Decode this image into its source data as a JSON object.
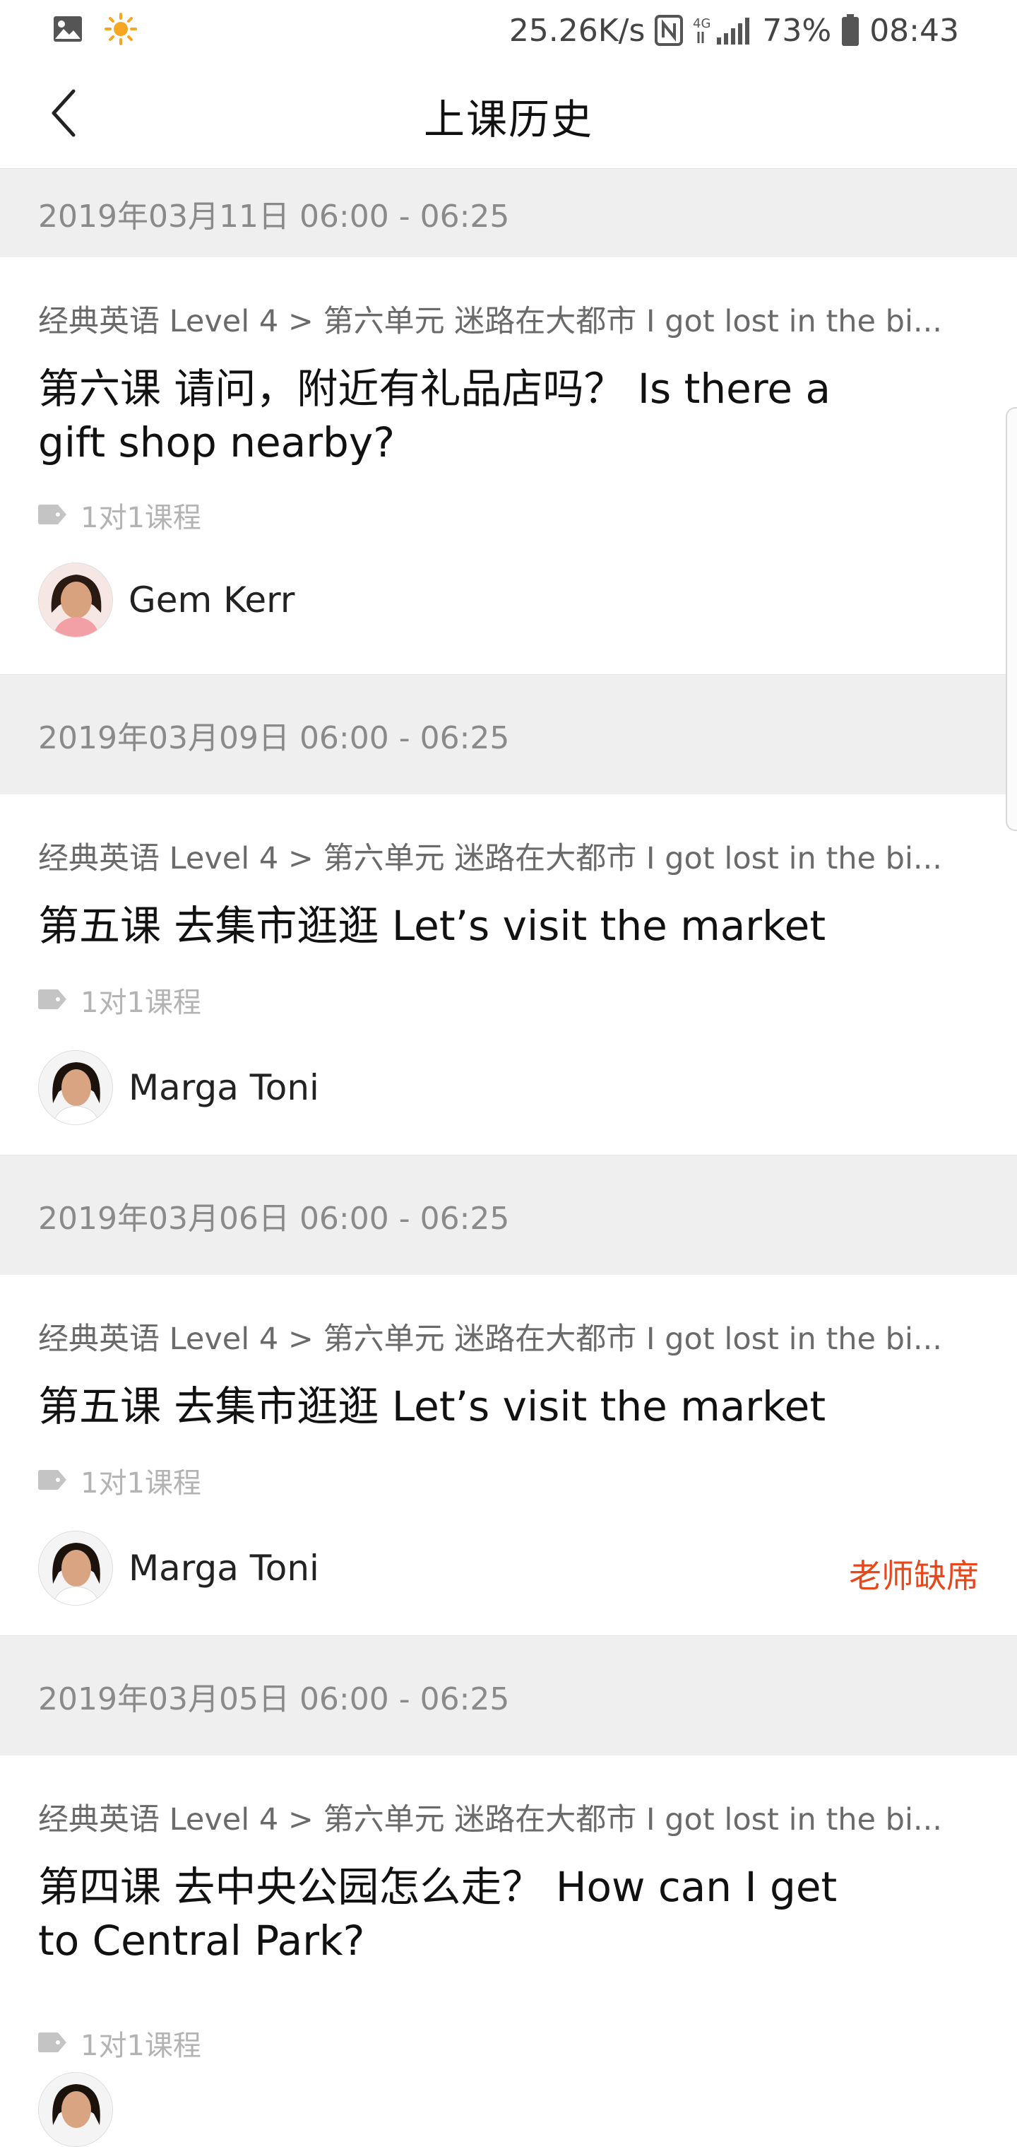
{
  "status_bar": {
    "network_speed": "25.26K/s",
    "signal_label": "4G",
    "battery": "73%",
    "time": "08:43",
    "icons": [
      "image-icon",
      "sun-icon",
      "nfc-icon",
      "signal-icon",
      "battery-icon"
    ]
  },
  "header": {
    "title": "上课历史",
    "back_icon": "chevron-left-icon"
  },
  "records": [
    {
      "date": "2019年03月11日 06:00 - 06:25",
      "course_path": "经典英语 Level 4 > 第六单元 迷路在大都市 I got lost in the bi...",
      "lesson_title": "第六课 请问，附近有礼品店吗？ Is there a gift shop nearby?",
      "tag": "1对1课程",
      "teacher": "Gem Kerr",
      "status": ""
    },
    {
      "date": "2019年03月09日 06:00 - 06:25",
      "course_path": "经典英语 Level 4 > 第六单元 迷路在大都市 I got lost in the bi...",
      "lesson_title": "第五课 去集市逛逛 Let’s visit the market",
      "tag": "1对1课程",
      "teacher": "Marga Toni",
      "status": ""
    },
    {
      "date": "2019年03月06日 06:00 - 06:25",
      "course_path": "经典英语 Level 4 > 第六单元 迷路在大都市 I got lost in the bi...",
      "lesson_title": "第五课 去集市逛逛 Let’s visit the market",
      "tag": "1对1课程",
      "teacher": "Marga Toni",
      "status": "老师缺席"
    },
    {
      "date": "2019年03月05日 06:00 - 06:25",
      "course_path": "经典英语 Level 4 > 第六单元 迷路在大都市 I got lost in the bi...",
      "lesson_title": "第四课 去中央公园怎么走？ How can I get to Central Park?",
      "tag": "1对1课程",
      "teacher": "",
      "status": ""
    }
  ],
  "colors": {
    "section_bg": "#efefef",
    "absent_status": "#e8471c",
    "secondary_text": "#8a8a8a",
    "tag_text": "#b3b3b3"
  }
}
